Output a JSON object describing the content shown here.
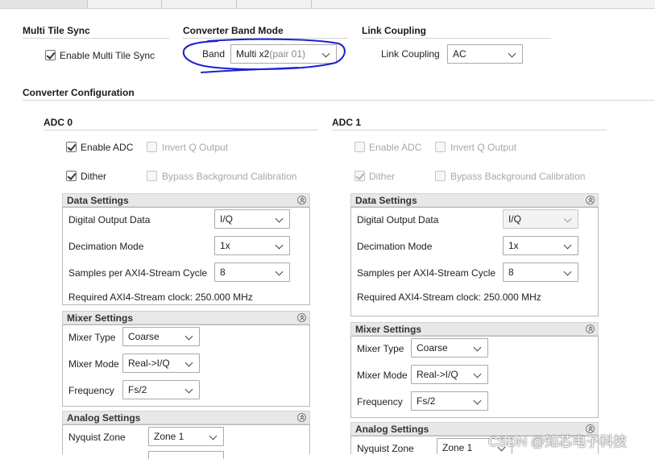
{
  "multi_tile_sync": {
    "title": "Multi Tile Sync",
    "enable_label": "Enable Multi Tile Sync",
    "enable_checked": true
  },
  "band_mode": {
    "title": "Converter Band Mode",
    "band_label": "Band",
    "band_value": "Multi x2",
    "band_value_suffix": "(pair 01)"
  },
  "link_coupling": {
    "title": "Link Coupling",
    "label": "Link Coupling",
    "value": "AC"
  },
  "converter_config": {
    "title": "Converter Configuration"
  },
  "adc0": {
    "title": "ADC 0",
    "enable_adc": {
      "label": "Enable ADC",
      "checked": true
    },
    "invert_q": {
      "label": "Invert Q Output",
      "checked": false
    },
    "dither": {
      "label": "Dither",
      "checked": true
    },
    "bypass_cal": {
      "label": "Bypass Background Calibration",
      "checked": false
    },
    "data_settings": {
      "title": "Data Settings",
      "digital_output_label": "Digital Output Data",
      "digital_output_value": "I/Q",
      "decimation_label": "Decimation Mode",
      "decimation_value": "1x",
      "samples_label": "Samples per AXI4-Stream Cycle",
      "samples_value": "8",
      "clock_text": "Required AXI4-Stream clock: 250.000 MHz"
    },
    "mixer_settings": {
      "title": "Mixer Settings",
      "type_label": "Mixer Type",
      "type_value": "Coarse",
      "mode_label": "Mixer Mode",
      "mode_value": "Real->I/Q",
      "freq_label": "Frequency",
      "freq_value": "Fs/2"
    },
    "analog_settings": {
      "title": "Analog Settings",
      "nyquist_label": "Nyquist Zone",
      "nyquist_value": "Zone 1"
    }
  },
  "adc1": {
    "title": "ADC 1",
    "enable_adc": {
      "label": "Enable ADC",
      "checked": false
    },
    "invert_q": {
      "label": "Invert Q Output",
      "checked": false
    },
    "dither": {
      "label": "Dither",
      "checked": true
    },
    "bypass_cal": {
      "label": "Bypass Background Calibration",
      "checked": false
    },
    "data_settings": {
      "title": "Data Settings",
      "digital_output_label": "Digital Output Data",
      "digital_output_value": "I/Q",
      "decimation_label": "Decimation Mode",
      "decimation_value": "1x",
      "samples_label": "Samples per AXI4-Stream Cycle",
      "samples_value": "8",
      "clock_text": "Required AXI4-Stream clock: 250.000 MHz"
    },
    "mixer_settings": {
      "title": "Mixer Settings",
      "type_label": "Mixer Type",
      "type_value": "Coarse",
      "mode_label": "Mixer Mode",
      "mode_value": "Real->I/Q",
      "freq_label": "Frequency",
      "freq_value": "Fs/2"
    },
    "analog_settings": {
      "title": "Analog Settings",
      "nyquist_label": "Nyquist Zone",
      "nyquist_value": "Zone 1"
    }
  },
  "annotation": {
    "color": "#1c1fd0"
  },
  "watermark": {
    "text": "CSDN @知芯电子科技"
  }
}
